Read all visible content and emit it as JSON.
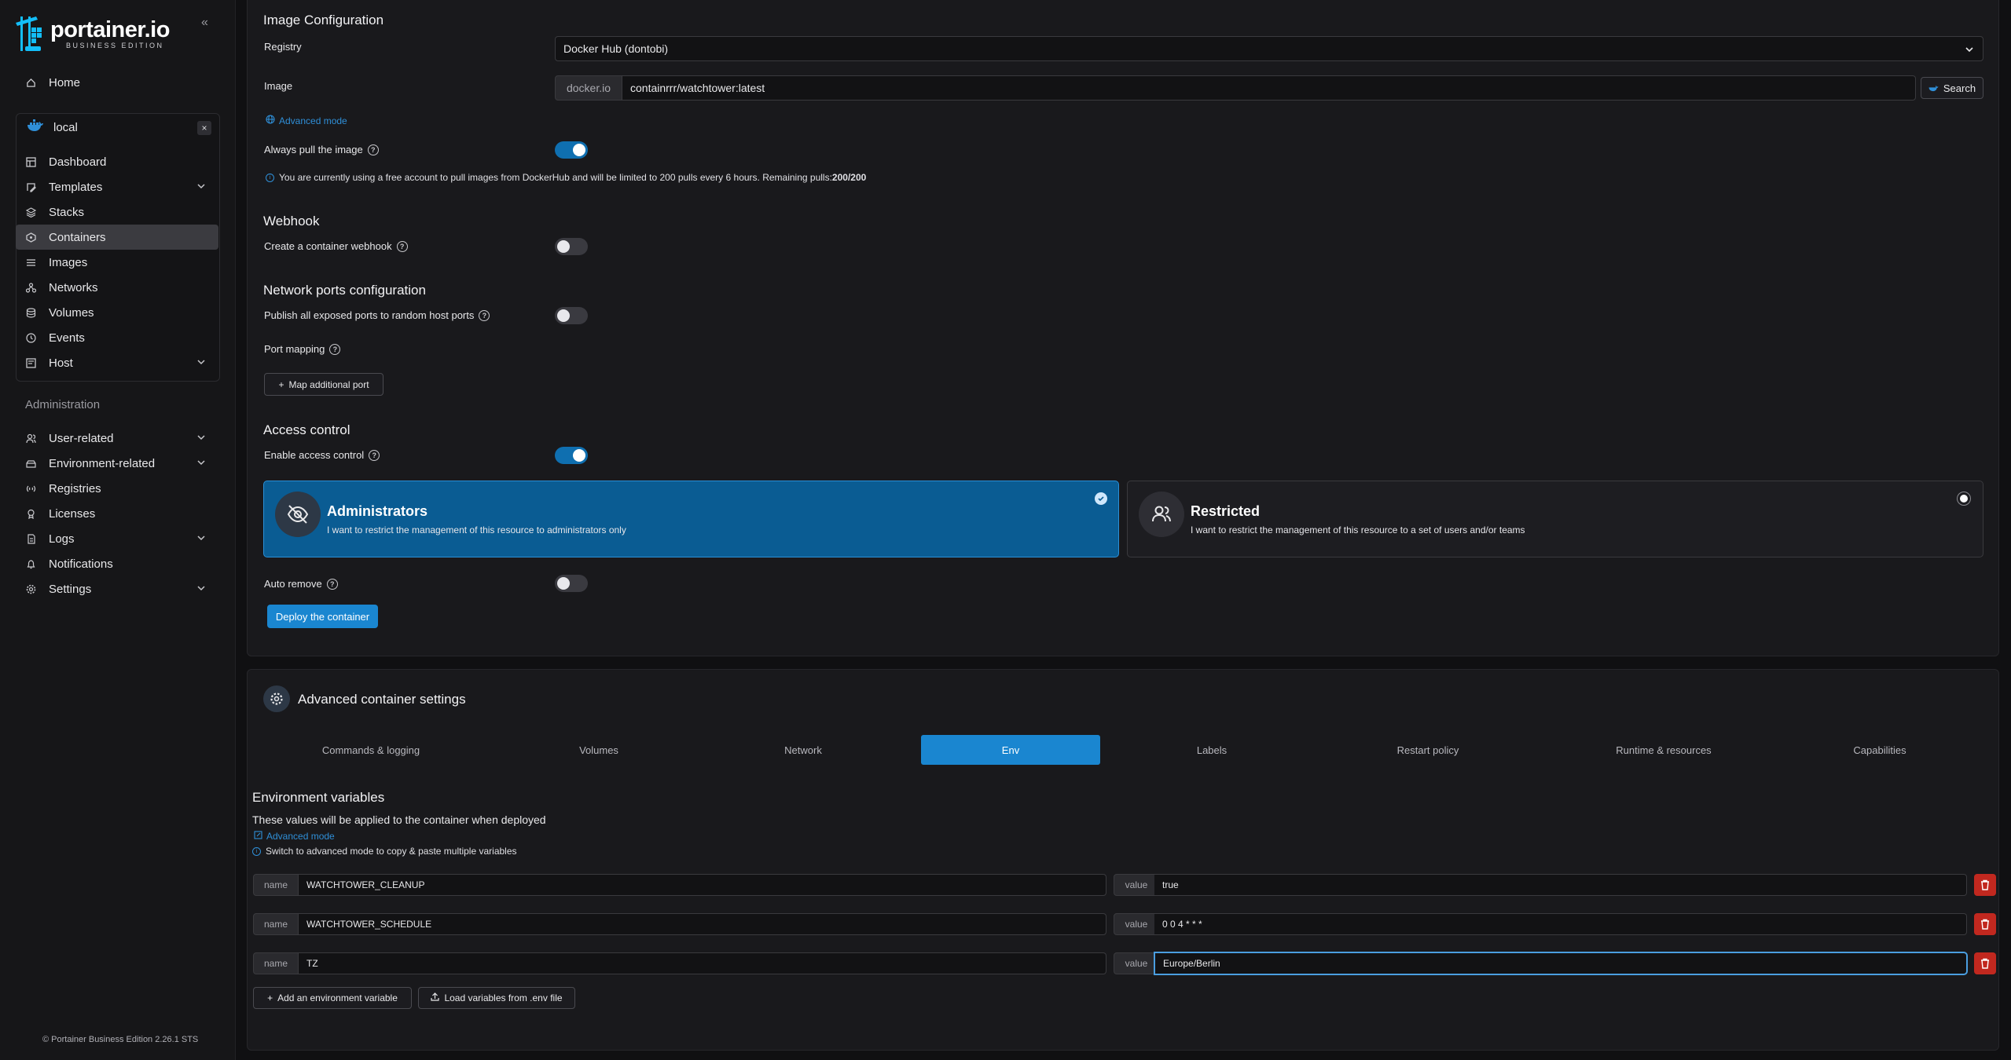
{
  "brand": {
    "name": "portainer.io",
    "edition": "BUSINESS EDITION"
  },
  "sidebar": {
    "home": "Home",
    "environment": {
      "name": "local",
      "close": "×"
    },
    "env_items": [
      {
        "label": "Dashboard",
        "icon": "dashboard-icon"
      },
      {
        "label": "Templates",
        "icon": "templates-icon"
      },
      {
        "label": "Stacks",
        "icon": "stacks-icon"
      },
      {
        "label": "Containers",
        "icon": "containers-icon"
      },
      {
        "label": "Images",
        "icon": "images-icon"
      },
      {
        "label": "Networks",
        "icon": "networks-icon"
      },
      {
        "label": "Volumes",
        "icon": "volumes-icon"
      },
      {
        "label": "Events",
        "icon": "events-icon"
      },
      {
        "label": "Host",
        "icon": "host-icon"
      }
    ],
    "admin_heading": "Administration",
    "admin_items": [
      {
        "label": "User-related"
      },
      {
        "label": "Environment-related"
      },
      {
        "label": "Registries"
      },
      {
        "label": "Licenses"
      },
      {
        "label": "Logs"
      },
      {
        "label": "Notifications"
      },
      {
        "label": "Settings"
      }
    ],
    "footer": "© Portainer Business Edition 2.26.1 STS"
  },
  "image_config": {
    "title": "Image Configuration",
    "registry_label": "Registry",
    "registry_value": "Docker Hub (dontobi)",
    "image_label": "Image",
    "image_prefix": "docker.io",
    "image_value": "containrrr/watchtower:latest",
    "search_label": "Search",
    "advanced_mode": "Advanced mode",
    "always_pull_label": "Always pull the image",
    "always_pull_on": true,
    "pull_info": "You are currently using a free account to pull images from DockerHub and will be limited to 200 pulls every 6 hours. Remaining pulls:",
    "pull_remaining": "200/200"
  },
  "webhook": {
    "title": "Webhook",
    "label": "Create a container webhook",
    "on": false
  },
  "network_ports": {
    "title": "Network ports configuration",
    "publish_label": "Publish all exposed ports to random host ports",
    "port_mapping_label": "Port mapping",
    "map_port_button": "Map additional port"
  },
  "access_control": {
    "title": "Access control",
    "enable_label": "Enable access control",
    "admins_title": "Administrators",
    "admins_desc": "I want to restrict the management of this resource to administrators only",
    "restricted_title": "Restricted",
    "restricted_desc": "I want to restrict the management of this resource to a set of users and/or teams"
  },
  "auto_remove_label": "Auto remove",
  "deploy_button": "Deploy the container",
  "advanced": {
    "title": "Advanced container settings",
    "tabs": [
      "Commands & logging",
      "Volumes",
      "Network",
      "Env",
      "Labels",
      "Restart policy",
      "Runtime & resources",
      "Capabilities"
    ],
    "active_tab": "Env"
  },
  "env_vars": {
    "title": "Environment variables",
    "subtitle": "These values will be applied to the container when deployed",
    "advanced_mode": "Advanced mode",
    "hint": "Switch to advanced mode to copy & paste multiple variables",
    "name_label": "name",
    "value_label": "value",
    "rows": [
      {
        "name": "WATCHTOWER_CLEANUP",
        "value": "true"
      },
      {
        "name": "WATCHTOWER_SCHEDULE",
        "value": "0 0 4 * * *"
      },
      {
        "name": "TZ",
        "value": "Europe/Berlin"
      }
    ],
    "add_button": "Add an environment variable",
    "load_button": "Load variables from .env file"
  },
  "colors": {
    "accent": "#1a86d0",
    "danger": "#c1281f",
    "selected_card": "#0a5c93"
  }
}
